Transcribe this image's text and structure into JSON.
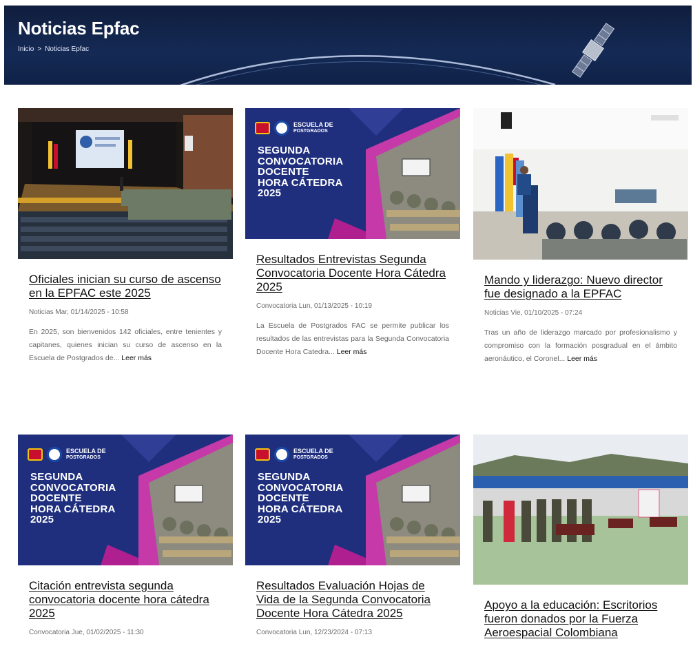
{
  "header": {
    "title": "Noticias Epfac",
    "breadcrumb": {
      "home": "Inicio",
      "separator": ">",
      "current": "Noticias Epfac"
    }
  },
  "promo_text": {
    "school": "ESCUELA DE",
    "school2": "POSTGRADOS",
    "lines": [
      "SEGUNDA",
      "CONVOCATORIA",
      "DOCENTE",
      "HORA CÁTEDRA",
      "2025"
    ]
  },
  "cards": [
    {
      "title": "Oficiales inician su curso de ascenso en la EPFAC este 2025",
      "meta": "Noticias Mar, 01/14/2025 - 10:58",
      "excerpt": "En 2025, son bienvenidos 142 oficiales, entre tenientes y capitanes, quienes inician su curso de ascenso en la Escuela de Postgrados de...",
      "more": "Leer más",
      "image": "auditorium-photo"
    },
    {
      "title": "Resultados Entrevistas Segunda Convocatoria Docente Hora Cátedra 2025",
      "meta": "Convocatoria Lun, 01/13/2025 - 10:19",
      "excerpt": "La Escuela de Postgrados FAC se permite publicar los resultados de las entrevistas para la Segunda Convocatoria Docente Hora Catedra...",
      "more": "Leer más",
      "image": "promo-graphic"
    },
    {
      "title": "Mando y liderazgo: Nuevo director fue designado a la EPFAC",
      "meta": "Noticias Vie, 01/10/2025 - 07:24",
      "excerpt": "Tras un año de liderazgo marcado por profesionalismo y compromiso con la formación posgradual en el ámbito aeronáutico, el Coronel...",
      "more": "Leer más",
      "image": "ceremony-photo"
    },
    {
      "title": "Citación entrevista segunda convocatoria docente hora cátedra 2025",
      "meta": "Convocatoria Jue, 01/02/2025 - 11:30",
      "image": "promo-graphic"
    },
    {
      "title": "Resultados Evaluación Hojas de Vida de la Segunda Convocatoria Docente Hora Cátedra 2025",
      "meta": "Convocatoria Lun, 12/23/2024 - 07:13",
      "image": "promo-graphic"
    },
    {
      "title": "Apoyo a la educación: Escritorios fueron donados por la Fuerza Aeroespacial Colombiana",
      "image": "donation-photo"
    }
  ]
}
